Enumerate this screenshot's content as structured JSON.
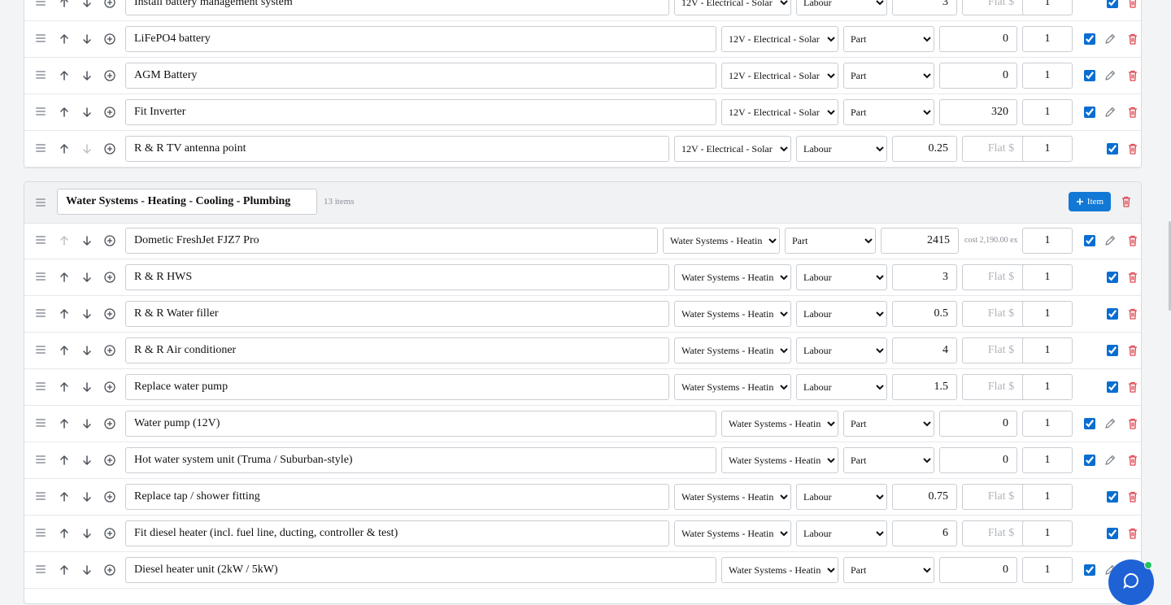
{
  "sectionA": {
    "rows": [
      {
        "name": "Install battery management system",
        "category": "12V - Electrical - Solar",
        "type": "Labour",
        "value": "3",
        "flat_placeholder": "Flat $",
        "qty": "1",
        "checked": true
      },
      {
        "name": "LiFePO4 battery",
        "category": "12V - Electrical - Solar",
        "type": "Part",
        "value": "0",
        "qty": "1",
        "checked": true
      },
      {
        "name": "AGM Battery",
        "category": "12V - Electrical - Solar",
        "type": "Part",
        "value": "0",
        "qty": "1",
        "checked": true
      },
      {
        "name": "Fit Inverter",
        "category": "12V - Electrical - Solar",
        "type": "Part",
        "value": "320",
        "qty": "1",
        "checked": true
      },
      {
        "name": "R & R TV antenna point",
        "category": "12V - Electrical - Solar",
        "type": "Labour",
        "value": "0.25",
        "flat_placeholder": "Flat $",
        "qty": "1",
        "checked": true
      }
    ]
  },
  "sectionB": {
    "name": "Water Systems - Heating - Cooling - Plumbing",
    "count": "13 items",
    "add_label": "Item",
    "rows": [
      {
        "name": "Dometic FreshJet FJZ7 Pro",
        "category": "Water Systems - Heating",
        "type": "Part",
        "value": "2415",
        "cost": "cost 2,190.00 ex",
        "qty": "1",
        "checked": true
      },
      {
        "name": "R & R HWS",
        "category": "Water Systems - Heating",
        "type": "Labour",
        "value": "3",
        "flat_placeholder": "Flat $",
        "qty": "1",
        "checked": true
      },
      {
        "name": "R & R Water filler",
        "category": "Water Systems - Heating",
        "type": "Labour",
        "value": "0.5",
        "flat_placeholder": "Flat $",
        "qty": "1",
        "checked": true
      },
      {
        "name": "R & R Air conditioner",
        "category": "Water Systems - Heating",
        "type": "Labour",
        "value": "4",
        "flat_placeholder": "Flat $",
        "qty": "1",
        "checked": true
      },
      {
        "name": "Replace water pump",
        "category": "Water Systems - Heating",
        "type": "Labour",
        "value": "1.5",
        "flat_placeholder": "Flat $",
        "qty": "1",
        "checked": true
      },
      {
        "name": "Water pump (12V)",
        "category": "Water Systems - Heating",
        "type": "Part",
        "value": "0",
        "qty": "1",
        "checked": true
      },
      {
        "name": "Hot water system unit (Truma / Suburban-style)",
        "category": "Water Systems - Heating",
        "type": "Part",
        "value": "0",
        "qty": "1",
        "checked": true
      },
      {
        "name": "Replace tap / shower fitting",
        "category": "Water Systems - Heating",
        "type": "Labour",
        "value": "0.75",
        "flat_placeholder": "Flat $",
        "qty": "1",
        "checked": true
      },
      {
        "name": "Fit diesel heater (incl. fuel line, ducting, controller & test)",
        "category": "Water Systems - Heating",
        "type": "Labour",
        "value": "6",
        "flat_placeholder": "Flat $",
        "qty": "1",
        "checked": true
      },
      {
        "name": "Diesel heater unit (2kW / 5kW)",
        "category": "Water Systems - Heating",
        "type": "Part",
        "value": "0",
        "qty": "1",
        "checked": true
      }
    ]
  },
  "icons": {
    "drag": "drag-handle-icon",
    "up": "arrow-up-icon",
    "down": "arrow-down-icon",
    "add": "plus-circle-icon",
    "edit": "pencil-icon",
    "delete": "trash-icon",
    "chat": "chat-icon"
  },
  "colors": {
    "accent": "#1278d6",
    "danger": "#e0464f",
    "fab": "#1f62d6",
    "online": "#22c55e"
  }
}
